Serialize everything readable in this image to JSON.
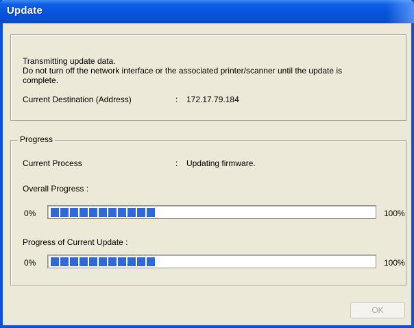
{
  "window": {
    "title": "Update"
  },
  "message": {
    "line1": "Transmitting update data.",
    "line2": "Do not turn off the network interface or the associated printer/scanner until the update is",
    "line3": "complete."
  },
  "destination": {
    "label": "Current Destination (Address)",
    "separator": ":",
    "value": "172.17.79.184"
  },
  "progress_group": {
    "label": "Progress",
    "current_process": {
      "label": "Current Process",
      "separator": ":",
      "value": "Updating firmware."
    },
    "overall": {
      "label": "Overall Progress :",
      "min_label": "0%",
      "max_label": "100%",
      "fraction": 0.34
    },
    "current_update": {
      "label": "Progress of Current Update :",
      "min_label": "0%",
      "max_label": "100%",
      "fraction": 0.34
    }
  },
  "buttons": {
    "ok_label": "OK",
    "ok_enabled": false
  },
  "colors": {
    "titlebar": "#0753dc",
    "progress_fill": "#2f68d8",
    "dialog_bg": "#ece9d8"
  }
}
